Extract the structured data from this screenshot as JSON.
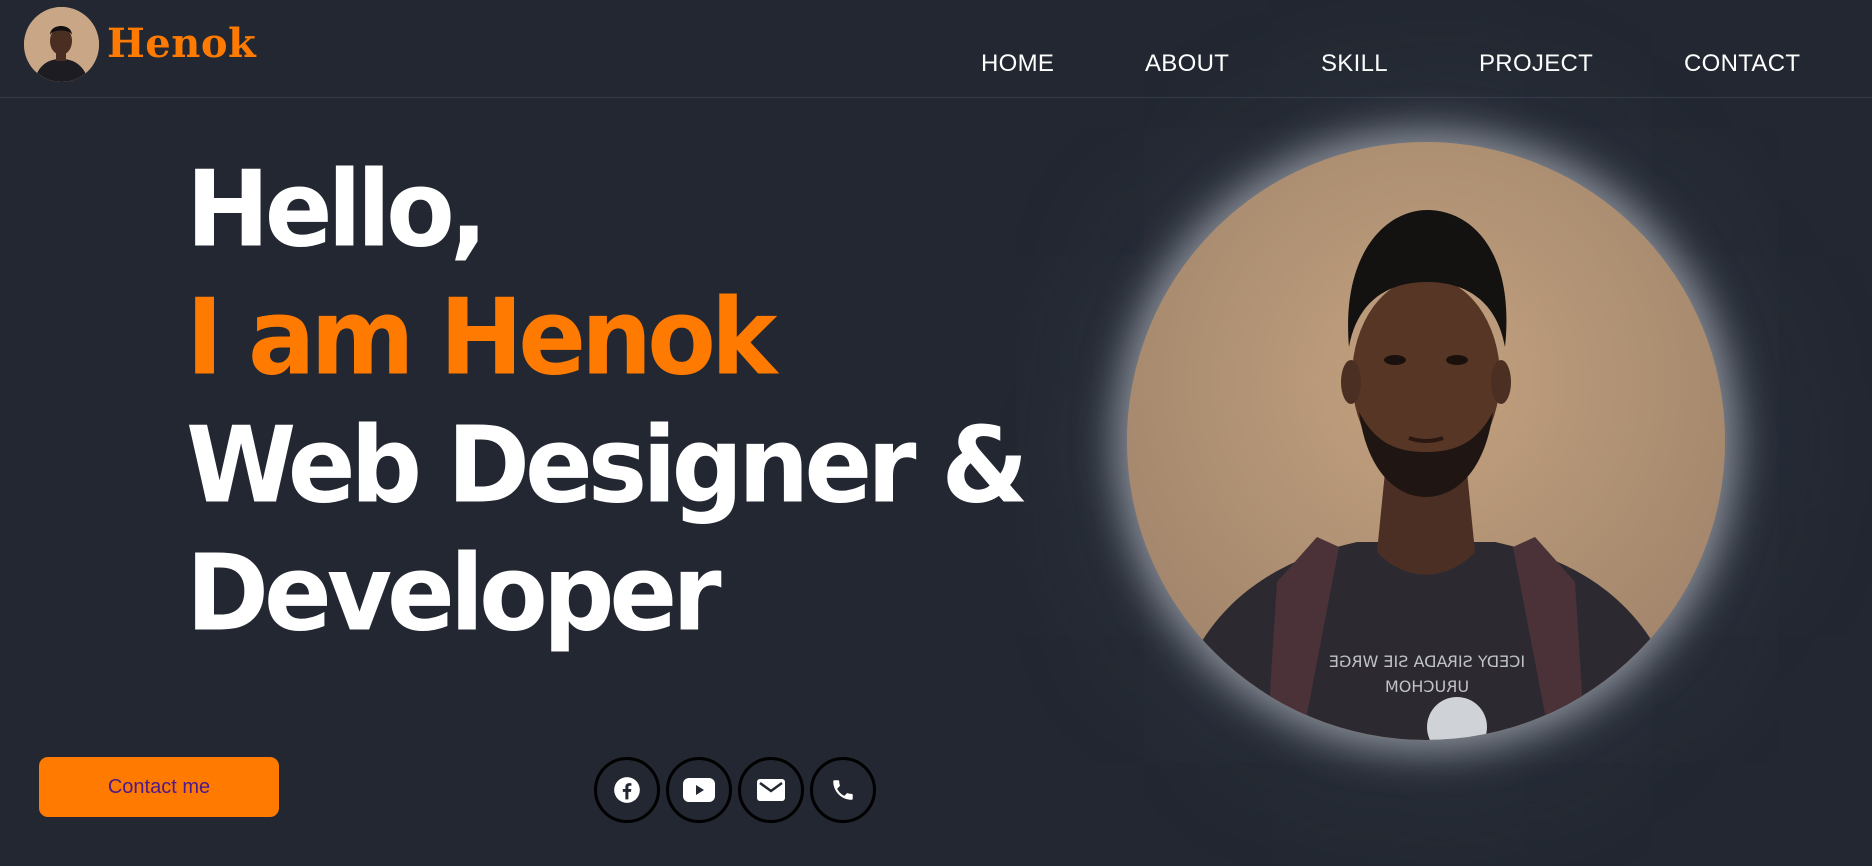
{
  "brand": {
    "name": "Henok",
    "accent": "#ff7a00"
  },
  "nav": {
    "items": [
      {
        "label": "HOME"
      },
      {
        "label": "ABOUT"
      },
      {
        "label": "SKILL"
      },
      {
        "label": "PROJECT"
      },
      {
        "label": "CONTACT"
      }
    ]
  },
  "hero": {
    "line1": "Hello,",
    "line2": "I am Henok",
    "line3": "Web Designer &",
    "line4": "Developer"
  },
  "cta": {
    "label": "Contact me"
  },
  "social": [
    {
      "icon": "facebook-icon"
    },
    {
      "icon": "youtube-icon"
    },
    {
      "icon": "mail-icon"
    },
    {
      "icon": "phone-icon"
    }
  ],
  "colors": {
    "background": "#222731",
    "accent": "#ff7a00",
    "text": "#ffffff",
    "button_text": "#4b1a8c"
  }
}
